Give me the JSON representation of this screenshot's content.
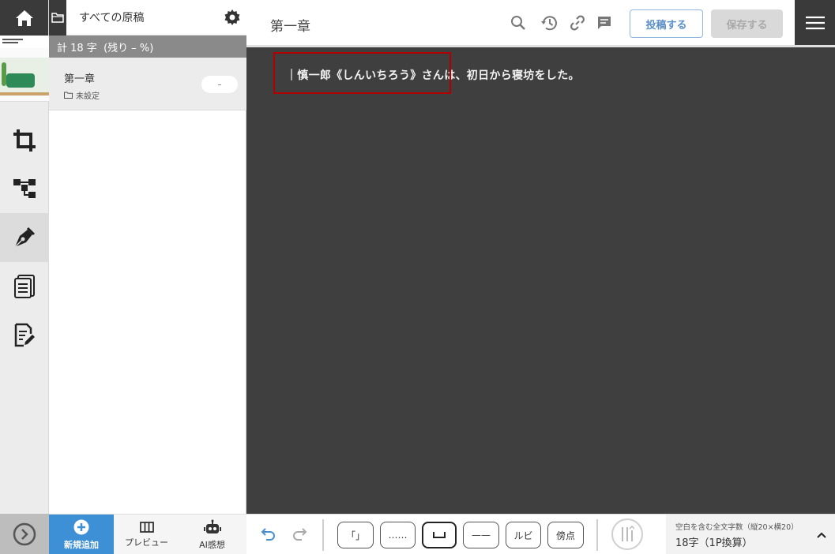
{
  "panel": {
    "title": "すべての原稿",
    "count": "計 18 字  (残り – %)",
    "doc": {
      "title": "第一章",
      "folder": "未設定",
      "badge": "–"
    },
    "footer": {
      "new": "新規追加",
      "preview": "プレビュー",
      "ai": "AI感想"
    }
  },
  "editor": {
    "chapter_title": "第一章",
    "post_label": "投稿する",
    "save_label": "保存する",
    "body_text": "｜慎一郎《しんいちろう》さんは、初日から寝坊をした。"
  },
  "bottombar": {
    "ins_bracket": "「」",
    "ins_ellipsis": "……",
    "ins_space": "␣",
    "ins_dash": "——",
    "ins_ruby": "ルビ",
    "ins_bouten": "傍点",
    "stats_label": "空白を含む全文字数（縦20×横20）",
    "stats_value": "18字（1P換算）"
  },
  "colors": {
    "accent": "#3d8fd6",
    "dark": "#3a3a3a",
    "editor_bg": "#3f3f3f",
    "highlight": "#b00000"
  }
}
